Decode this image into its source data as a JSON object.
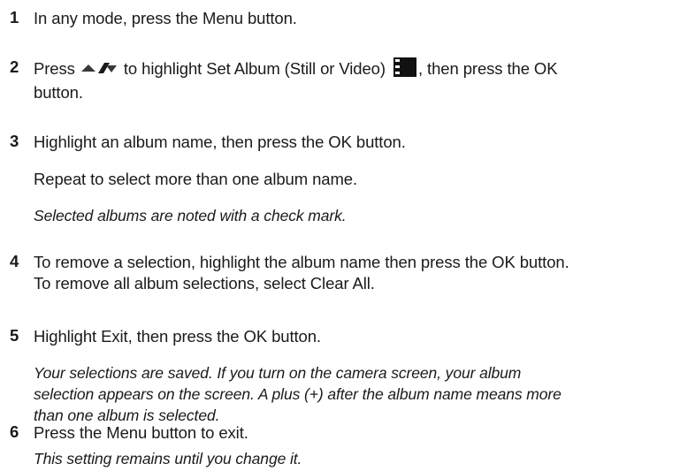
{
  "steps": [
    {
      "number": "1",
      "text": "In any mode, press the Menu button."
    },
    {
      "number": "2",
      "text_before_icon": "Press",
      "text_mid": "to highlight Set Album (Still or Video)",
      "text_after": ", then press the OK",
      "text_wrap": "button."
    },
    {
      "number": "3",
      "text": "Highlight an album name, then press the OK button.",
      "extra": "Repeat to select more than one album name.",
      "note": "Selected albums are noted with a check mark."
    },
    {
      "number": "4",
      "line1": "To remove a selection, highlight the album name then press the OK button.",
      "line2": "To remove all album selections, select Clear All."
    },
    {
      "number": "5",
      "text": "Highlight Exit, then press the OK button.",
      "note_lines": [
        "Your selections are saved. If you turn on the camera screen, your album",
        "selection appears on the screen. A plus (+) after the album name means more",
        "than one album is selected."
      ]
    },
    {
      "number": "6",
      "text": "Press the Menu button to exit.",
      "note": "This setting remains until you change it."
    }
  ],
  "icons": {
    "up_down": "up-down-arrows-icon",
    "album_mode": "album-mode-icon"
  }
}
